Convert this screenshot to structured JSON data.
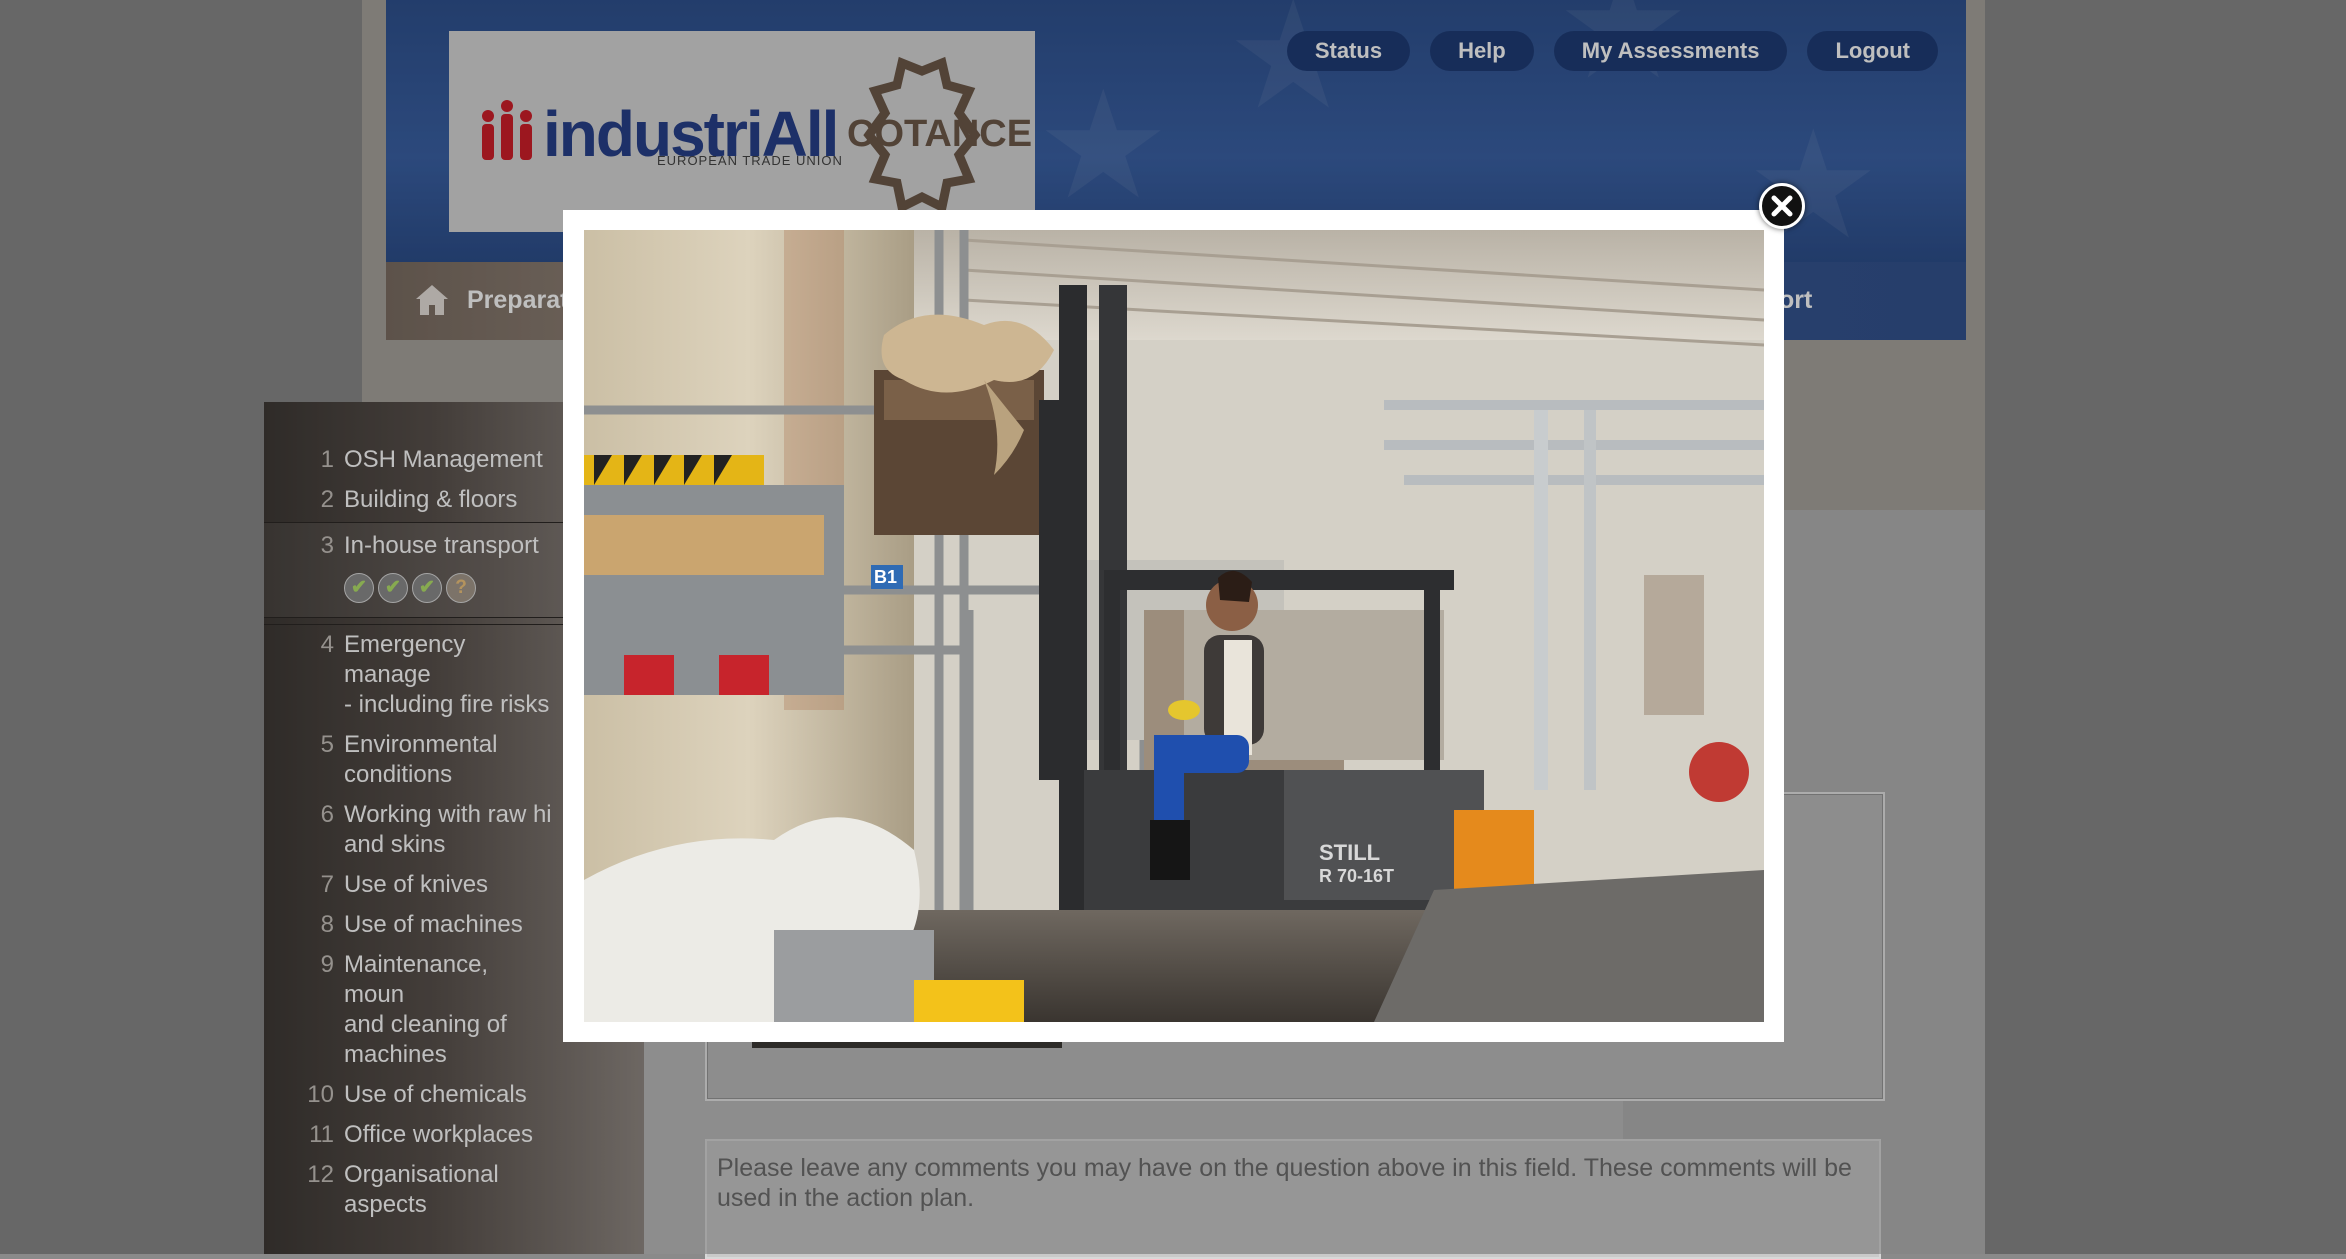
{
  "header": {
    "logo_industriall": "industriAll",
    "logo_industriall_sub": "EUROPEAN TRADE UNION",
    "logo_cotance": "COTANCE",
    "nav_buttons": [
      "Status",
      "Help",
      "My Assessments",
      "Logout"
    ]
  },
  "navbar": {
    "left_label": "Preparat",
    "right_label": "ort",
    "home_icon": "home-icon"
  },
  "sidebar": {
    "items": [
      {
        "num": "1",
        "label": "OSH Management"
      },
      {
        "num": "2",
        "label": "Building & floors"
      },
      {
        "num": "3",
        "label": "In-house transport",
        "active": true,
        "badges": [
          "check",
          "check",
          "check",
          "question"
        ]
      },
      {
        "num": "4",
        "label": "Emergency manage\n- including fire risks"
      },
      {
        "num": "5",
        "label": "Environmental\nconditions"
      },
      {
        "num": "6",
        "label": "Working with raw hi\nand skins"
      },
      {
        "num": "7",
        "label": "Use of knives"
      },
      {
        "num": "8",
        "label": "Use of machines"
      },
      {
        "num": "9",
        "label": "Maintenance, moun\nand cleaning of\nmachines"
      },
      {
        "num": "10",
        "label": "Use of chemicals"
      },
      {
        "num": "11",
        "label": "Office workplaces"
      },
      {
        "num": "12",
        "label": "Organisational aspects"
      }
    ]
  },
  "comment": {
    "placeholder": "Please leave any comments you may have on the question above in this field. These comments will be used in the action plan."
  },
  "modal": {
    "close_icon": "close-icon",
    "photo_subject": "forklift-photo",
    "forklift_text_1": "STILL",
    "forklift_text_2": "R 70-16T",
    "sign_text": "B1"
  },
  "colors": {
    "header_blue": "#2f5290",
    "nav_button": "#1f3d77",
    "sidebar_dark": "#3f3a36"
  }
}
